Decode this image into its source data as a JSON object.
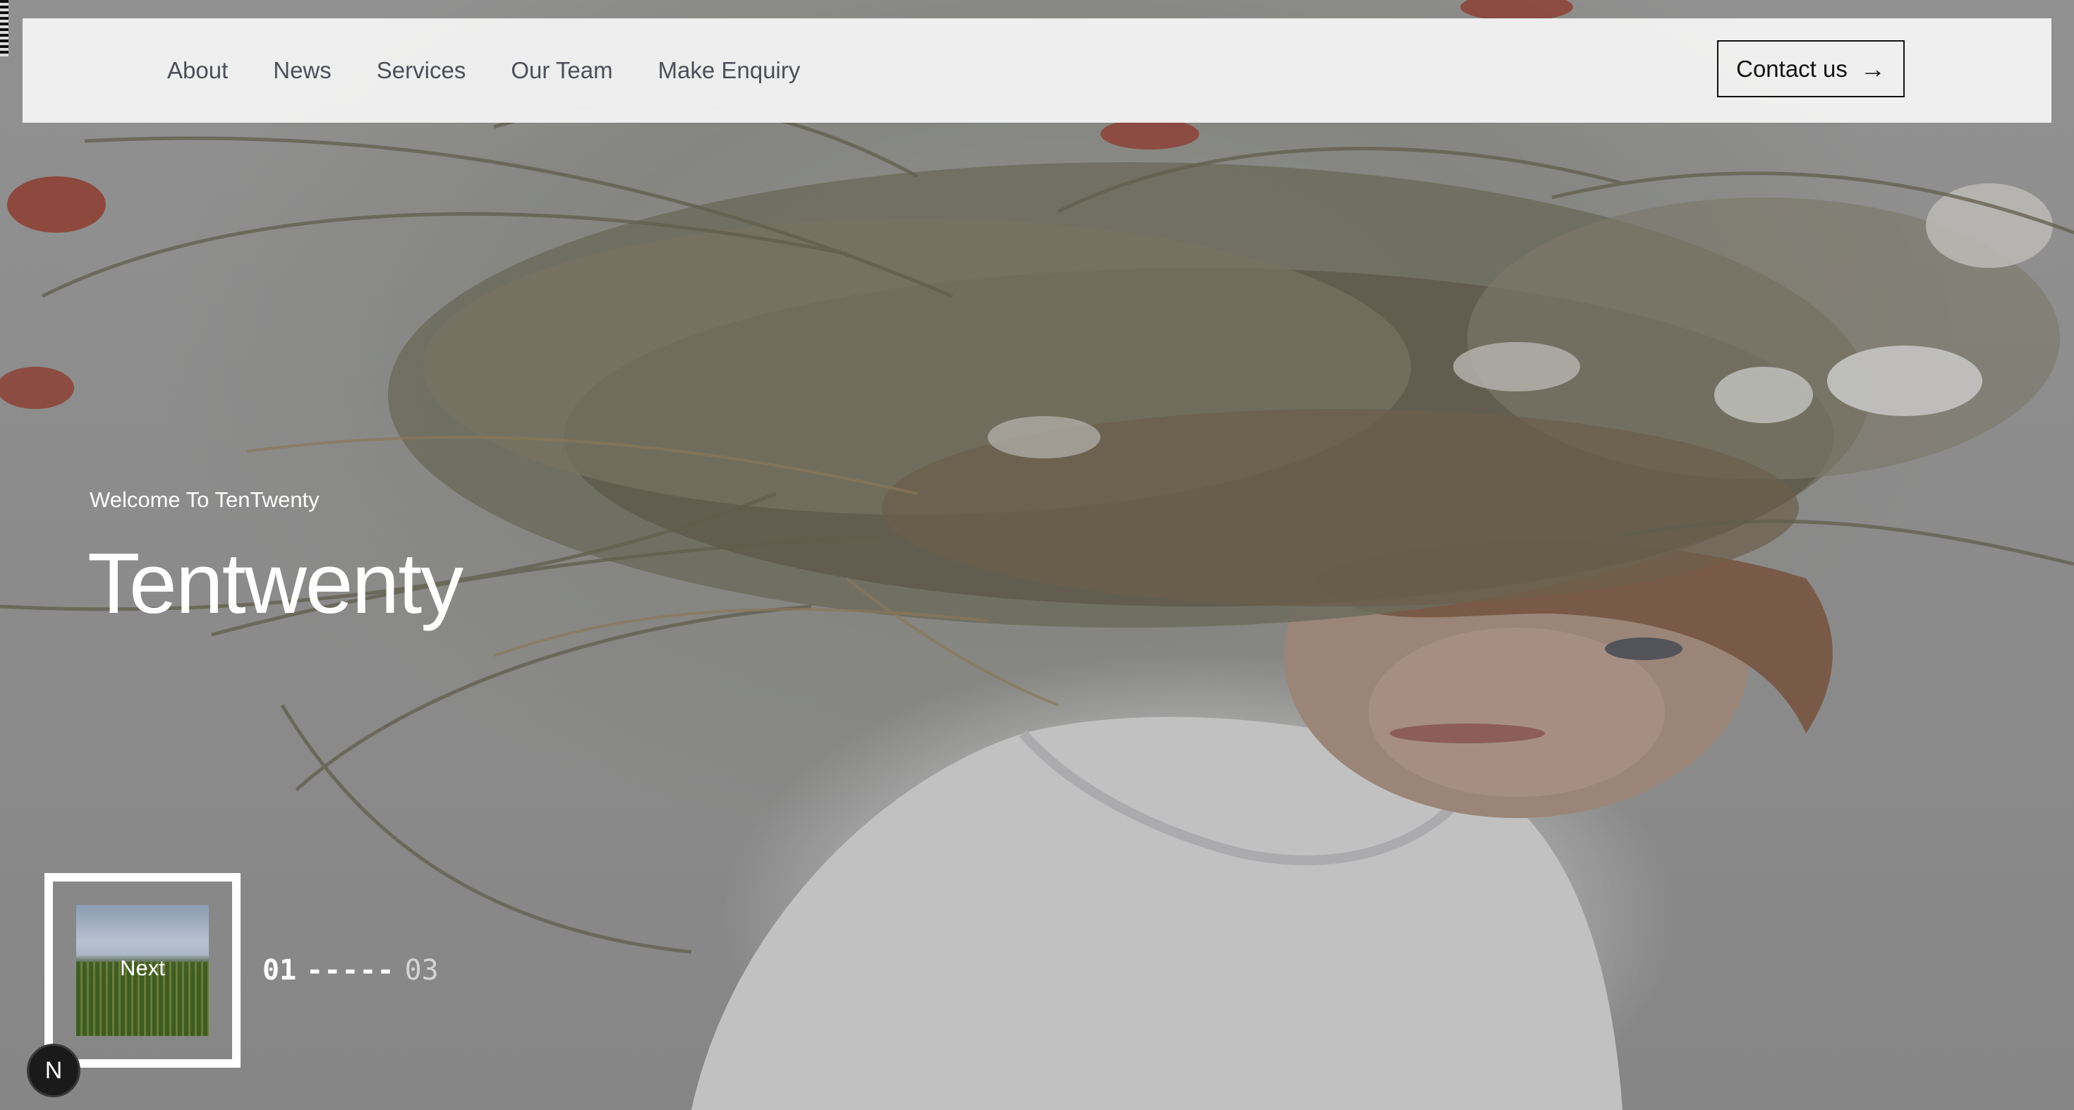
{
  "nav": {
    "links": [
      "About",
      "News",
      "Services",
      "Our Team",
      "Make Enquiry"
    ],
    "contact_label": "Contact us",
    "contact_arrow": "→"
  },
  "hero": {
    "welcome": "Welcome To TenTwenty",
    "headline": "Tentwenty"
  },
  "slider": {
    "next_label": "Next",
    "current": "01",
    "separator": "-----",
    "total": "03"
  },
  "badge": {
    "letter": "N"
  },
  "icons": {
    "contact": "arrow-right-icon",
    "badge": "n-logo-icon"
  },
  "colors": {
    "navbar_bg": "#f2f2f2",
    "nav_text": "#4b4f57",
    "hero_text": "#ffffff",
    "button_border": "#111111"
  }
}
